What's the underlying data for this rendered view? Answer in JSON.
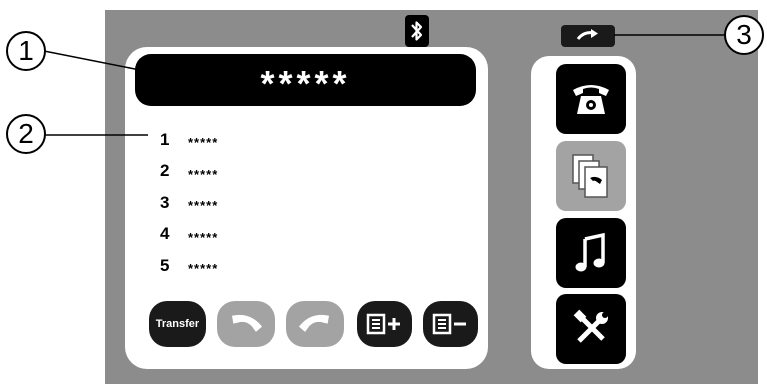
{
  "display": {
    "value": "*****"
  },
  "recent_list": [
    {
      "index": "1",
      "value": "*****"
    },
    {
      "index": "2",
      "value": "*****"
    },
    {
      "index": "3",
      "value": "*****"
    },
    {
      "index": "4",
      "value": "*****"
    },
    {
      "index": "5",
      "value": "*****"
    }
  ],
  "bottom_bar": {
    "transfer_label": "Transfer",
    "accept_icon": "phone-answer-icon",
    "hangup_icon": "phone-hangup-icon",
    "add_icon": "list-add-icon",
    "remove_icon": "list-remove-icon"
  },
  "side_menu": [
    {
      "icon": "telephone-icon",
      "state": "active"
    },
    {
      "icon": "call-list-icon",
      "state": "inactive"
    },
    {
      "icon": "music-note-icon",
      "state": "active"
    },
    {
      "icon": "tools-icon",
      "state": "active"
    }
  ],
  "status": {
    "bluetooth_icon": "bluetooth-icon",
    "back_icon": "back-arrow-icon"
  },
  "callouts": [
    "1",
    "2",
    "3"
  ],
  "colors": {
    "frame": "#8c8c8c",
    "button_dark": "#000000",
    "button_disabled": "#a3a3a3"
  }
}
